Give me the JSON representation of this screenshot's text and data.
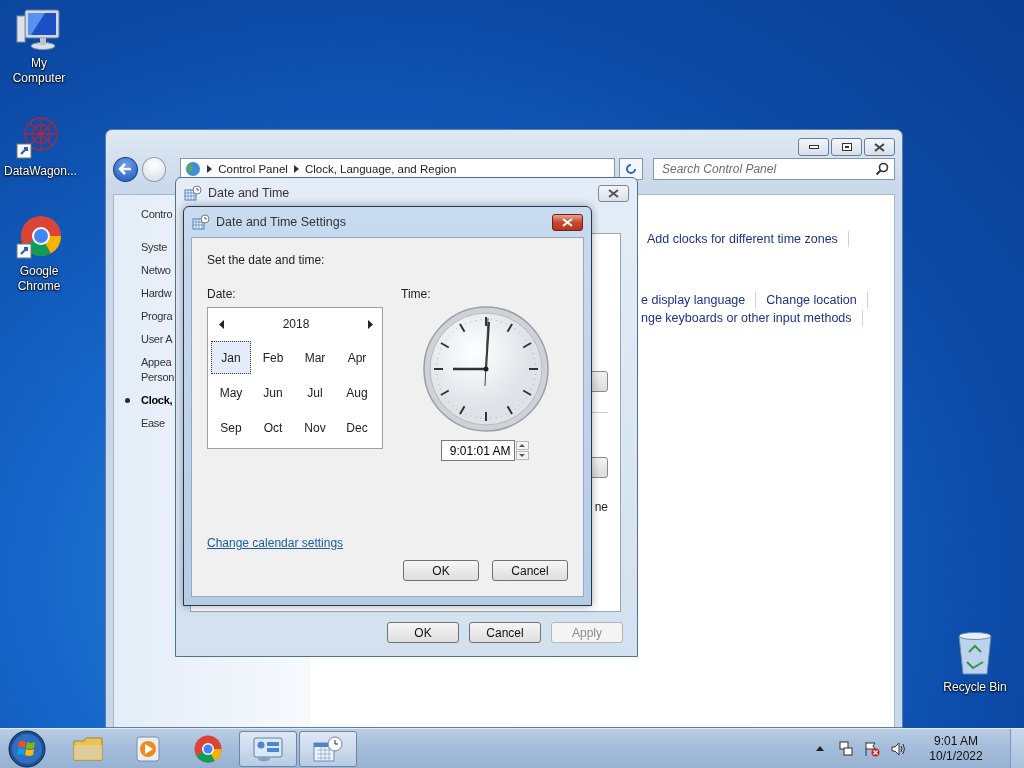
{
  "desktop_icons": [
    {
      "kind": "computer",
      "label": "My Computer"
    },
    {
      "kind": "shortcut-app",
      "label": "DataWagon..."
    },
    {
      "kind": "browser",
      "label": "Google Chrome"
    }
  ],
  "recycle_bin": {
    "label": "Recycle Bin"
  },
  "control_panel": {
    "breadcrumb": [
      "Control Panel",
      "Clock, Language, and Region"
    ],
    "search": {
      "placeholder": "Search Control Panel"
    },
    "nav": [
      {
        "kind": "home",
        "label": "Contro",
        "selected": false
      },
      {
        "kind": "category",
        "label": "Syste",
        "selected": false
      },
      {
        "kind": "category",
        "label": "Netwo",
        "selected": false
      },
      {
        "kind": "category",
        "label": "Hardw",
        "selected": false
      },
      {
        "kind": "category",
        "label": "Progra",
        "selected": false
      },
      {
        "kind": "category",
        "label": "User A",
        "selected": false
      },
      {
        "kind": "category",
        "label": "Appea\nPerson",
        "selected": false
      },
      {
        "kind": "category",
        "label": "Clock,",
        "selected": true
      },
      {
        "kind": "category",
        "label": "Ease",
        "selected": false
      }
    ],
    "sections": [
      {
        "rows": [
          [
            "Add clocks for different time zones"
          ]
        ]
      },
      {
        "rows": [
          [
            "e display language",
            "Change location"
          ],
          [
            "nge keyboards or other input methods"
          ]
        ]
      }
    ]
  },
  "date_time_dialog": {
    "title": "Date and Time",
    "panel_text": "ne",
    "buttons": [
      {
        "label": "OK",
        "disabled": false
      },
      {
        "label": "Cancel",
        "disabled": false
      },
      {
        "label": "Apply",
        "disabled": true
      }
    ]
  },
  "settings_dialog": {
    "title": "Date and Time Settings",
    "prompt": "Set the date and time:",
    "date_label": "Date:",
    "time_label": "Time:",
    "calendar": {
      "year": "2018",
      "months": [
        {
          "label": "Jan",
          "selected": true
        },
        {
          "label": "Feb",
          "selected": false
        },
        {
          "label": "Mar",
          "selected": false
        },
        {
          "label": "Apr",
          "selected": false
        },
        {
          "label": "May",
          "selected": false
        },
        {
          "label": "Jun",
          "selected": false
        },
        {
          "label": "Jul",
          "selected": false
        },
        {
          "label": "Aug",
          "selected": false
        },
        {
          "label": "Sep",
          "selected": false
        },
        {
          "label": "Oct",
          "selected": false
        },
        {
          "label": "Nov",
          "selected": false
        },
        {
          "label": "Dec",
          "selected": false
        }
      ]
    },
    "time": {
      "value": "9:01:01 AM"
    },
    "link": "Change calendar settings",
    "buttons": [
      "OK",
      "Cancel"
    ]
  },
  "taskbar": {
    "apps": [
      {
        "kind": "folder",
        "open": false
      },
      {
        "kind": "media",
        "open": false
      },
      {
        "kind": "browser",
        "open": false
      },
      {
        "kind": "control-panel",
        "open": true
      },
      {
        "kind": "date-time",
        "open": true
      }
    ],
    "clock": {
      "time": "9:01 AM",
      "date": "10/1/2022"
    }
  }
}
